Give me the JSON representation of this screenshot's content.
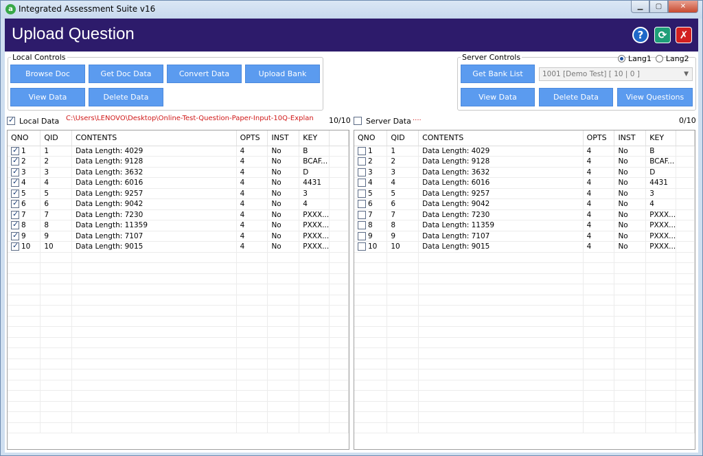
{
  "window": {
    "title": "Integrated Assessment Suite v16",
    "app_icon": "a",
    "min": "▁",
    "max": "▢",
    "close": "✕"
  },
  "header": {
    "title": "Upload Question",
    "help": "?",
    "refresh": "⟳",
    "close": "✗"
  },
  "local_controls": {
    "legend": "Local Controls",
    "buttons": {
      "browse": "Browse Doc",
      "get_doc": "Get Doc Data",
      "convert": "Convert Data",
      "upload": "Upload Bank",
      "view": "View Data",
      "delete": "Delete Data"
    }
  },
  "server_controls": {
    "legend": "Server Controls",
    "lang1": "Lang1",
    "lang2": "Lang2",
    "lang_selected": "Lang1",
    "buttons": {
      "get_bank": "Get Bank List",
      "view": "View Data",
      "delete": "Delete Data",
      "view_questions": "View Questions"
    },
    "bank_select": "1001 [Demo Test] [ 10 | 0 ]"
  },
  "local_data": {
    "label": "Local Data",
    "checked": true,
    "path": "C:\\Users\\LENOVO\\Desktop\\Online-Test-Question-Paper-Input-10Q-Explan",
    "count": "10/10"
  },
  "server_data": {
    "label": "Server Data",
    "checked": false,
    "path": "....",
    "count": "0/10"
  },
  "columns": [
    "QNO",
    "QID",
    "CONTENTS",
    "OPTS",
    "INST",
    "KEY"
  ],
  "rows": [
    {
      "qno": "1",
      "qid": "1",
      "contents": "Data Length: 4029",
      "opts": "4",
      "inst": "No",
      "key": "B"
    },
    {
      "qno": "2",
      "qid": "2",
      "contents": "Data Length: 9128",
      "opts": "4",
      "inst": "No",
      "key": "BCAF..."
    },
    {
      "qno": "3",
      "qid": "3",
      "contents": "Data Length: 3632",
      "opts": "4",
      "inst": "No",
      "key": "D"
    },
    {
      "qno": "4",
      "qid": "4",
      "contents": "Data Length: 6016",
      "opts": "4",
      "inst": "No",
      "key": "4431"
    },
    {
      "qno": "5",
      "qid": "5",
      "contents": "Data Length: 9257",
      "opts": "4",
      "inst": "No",
      "key": "3"
    },
    {
      "qno": "6",
      "qid": "6",
      "contents": "Data Length: 9042",
      "opts": "4",
      "inst": "No",
      "key": "4"
    },
    {
      "qno": "7",
      "qid": "7",
      "contents": "Data Length: 7230",
      "opts": "4",
      "inst": "No",
      "key": "PXXX..."
    },
    {
      "qno": "8",
      "qid": "8",
      "contents": "Data Length: 11359",
      "opts": "4",
      "inst": "No",
      "key": "PXXX..."
    },
    {
      "qno": "9",
      "qid": "9",
      "contents": "Data Length: 7107",
      "opts": "4",
      "inst": "No",
      "key": "PXXX..."
    },
    {
      "qno": "10",
      "qid": "10",
      "contents": "Data Length: 9015",
      "opts": "4",
      "inst": "No",
      "key": "PXXX..."
    }
  ],
  "colors": {
    "header_bg": "#2d1b6b",
    "button_bg": "#5b9bef",
    "path_text": "#d01818"
  }
}
